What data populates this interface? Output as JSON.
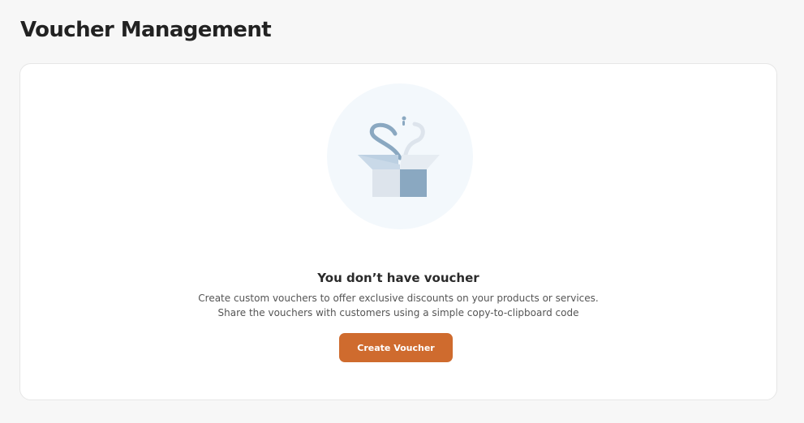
{
  "page": {
    "title": "Voucher Management"
  },
  "empty_state": {
    "illustration_icon": "open-box-icon",
    "title": "You don’t have voucher",
    "description_line1": "Create custom vouchers to offer exclusive discounts on your products or services.",
    "description_line2": "Share the vouchers with customers using a simple copy-to-clipboard code",
    "button_label": "Create Voucher"
  },
  "colors": {
    "background": "#f7f7f7",
    "card": "#ffffff",
    "primary_button": "#cf6b2e",
    "illustration_circle": "#f3f8fc",
    "box_dark": "#8aa8c1",
    "box_light": "#dde4ec",
    "box_flap": "#bcd0e2"
  }
}
